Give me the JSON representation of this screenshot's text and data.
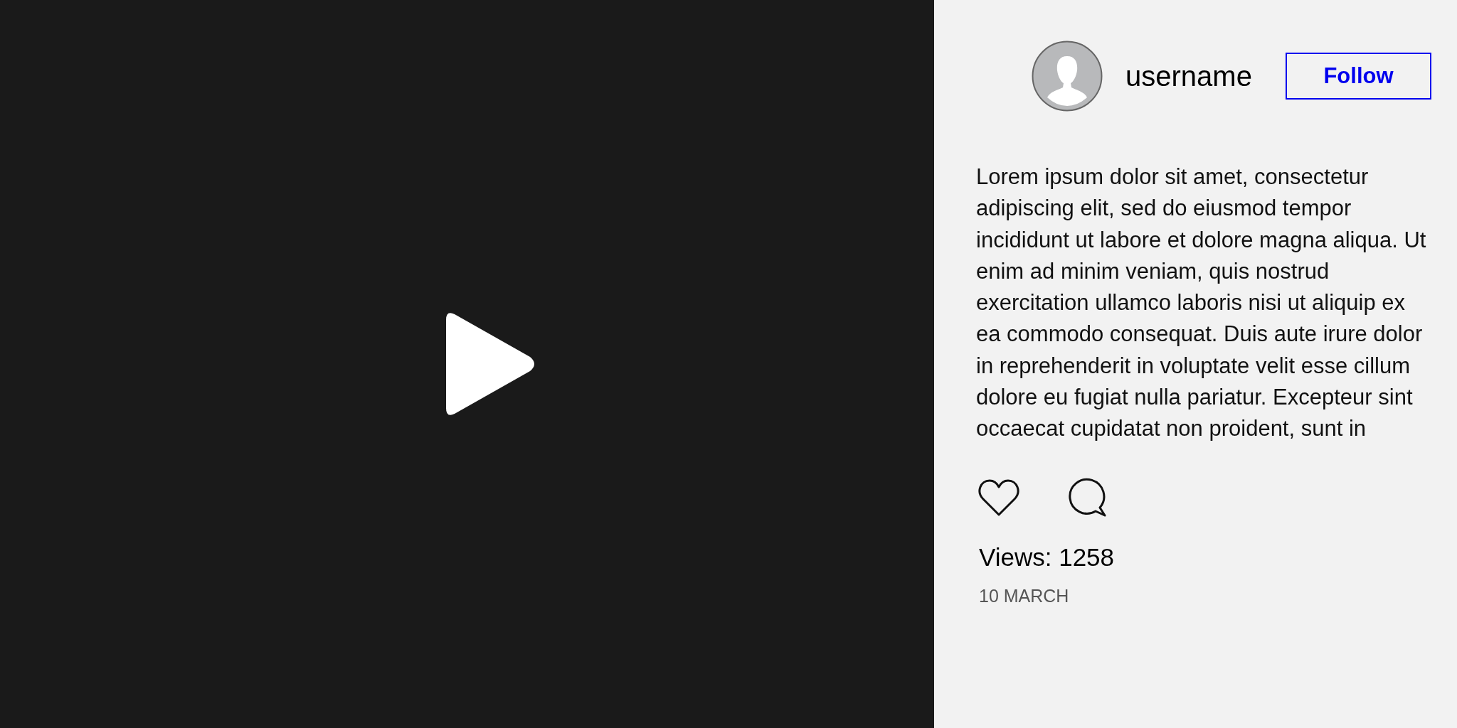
{
  "author": {
    "username": "username",
    "follow_label": "Follow"
  },
  "caption": "Lorem ipsum dolor sit amet, consectetur adipiscing elit, sed do eiusmod tempor incididunt ut labore et dolore magna aliqua. Ut enim ad minim veniam, quis nostrud exercitation ullamco laboris nisi ut aliquip ex ea commodo consequat. Duis aute irure dolor in reprehenderit in voluptate velit esse cillum dolore eu fugiat nulla pariatur. Excepteur sint occaecat cupidatat non proident, sunt in",
  "views": "Views: 1258",
  "date": "10 MARCH"
}
